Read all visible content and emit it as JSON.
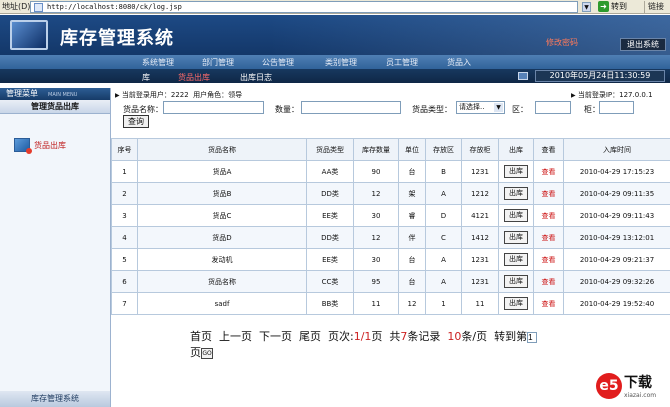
{
  "browser": {
    "address_label": "地址(D)",
    "url": "http://localhost:8080/ck/log.jsp",
    "go_label": "转到",
    "links_label": "链接"
  },
  "header": {
    "title": "库存管理系统",
    "change_password": "修改密码",
    "logout": "退出系统",
    "datetime": "2010年05月24日11:30:59",
    "nav_row1": [
      "系统管理",
      "部门管理",
      "公告管理",
      "类别管理",
      "员工管理",
      "货品入"
    ],
    "nav_row2": [
      "库",
      "货品出库",
      "出库日志"
    ]
  },
  "sidebar": {
    "menu_title": "管理菜单",
    "menu_title_en": "MAIN MENU",
    "section": "管理货品出库",
    "item": "货品出库",
    "footer": "库存管理系统"
  },
  "status": {
    "current_user": "当前登录用户：2222",
    "user_role": "用户角色：领导",
    "ip": "当前登录IP：127.0.0.1"
  },
  "search": {
    "name_label": "货品名称：",
    "quantity_label": "数量：",
    "type_label": "货品类型：",
    "type_value": "请选择..",
    "area_label": "区：",
    "cabinet_label": "柜：",
    "query_button": "查询"
  },
  "table": {
    "columns": [
      "序号",
      "货品名称",
      "货品类型",
      "库存数量",
      "单位",
      "存放区",
      "存放柜",
      "出库",
      "查看",
      "入库时间"
    ],
    "out_label": "出库",
    "view_label": "查看",
    "rows": [
      [
        "1",
        "货品A",
        "AA类",
        "90",
        "台",
        "B",
        "1231",
        "2010-04-29 17:15:23"
      ],
      [
        "2",
        "货品B",
        "DD类",
        "12",
        "架",
        "A",
        "1212",
        "2010-04-29 09:11:35"
      ],
      [
        "3",
        "货品C",
        "EE类",
        "30",
        "睿",
        "D",
        "4121",
        "2010-04-29 09:11:43"
      ],
      [
        "4",
        "货品D",
        "DD类",
        "12",
        "伴",
        "C",
        "1412",
        "2010-04-29 13:12:01"
      ],
      [
        "5",
        "发动机",
        "EE类",
        "30",
        "台",
        "A",
        "1231",
        "2010-04-29 09:21:37"
      ],
      [
        "6",
        "货品名称",
        "CC类",
        "95",
        "台",
        "A",
        "1231",
        "2010-04-29 09:32:26"
      ],
      [
        "7",
        "sadf",
        "BB类",
        "11",
        "12",
        "1",
        "11",
        "2010-04-29 19:52:40"
      ]
    ]
  },
  "pager": {
    "first": "首页",
    "prev": "上一页",
    "next": "下一页",
    "last": "尾页",
    "page_label": "页次:",
    "page_current": "1/1",
    "page_suffix": "页",
    "total_prefix": "共",
    "total_count": "7",
    "total_suffix": "条记录",
    "per_page": "10",
    "per_page_suffix": "条/页",
    "goto_label": "转到第",
    "goto_value": "1",
    "goto_suffix": "页",
    "go_button": "GO"
  },
  "watermark": {
    "logo": "e5",
    "text": "下载",
    "domain": "xiazai.com"
  }
}
